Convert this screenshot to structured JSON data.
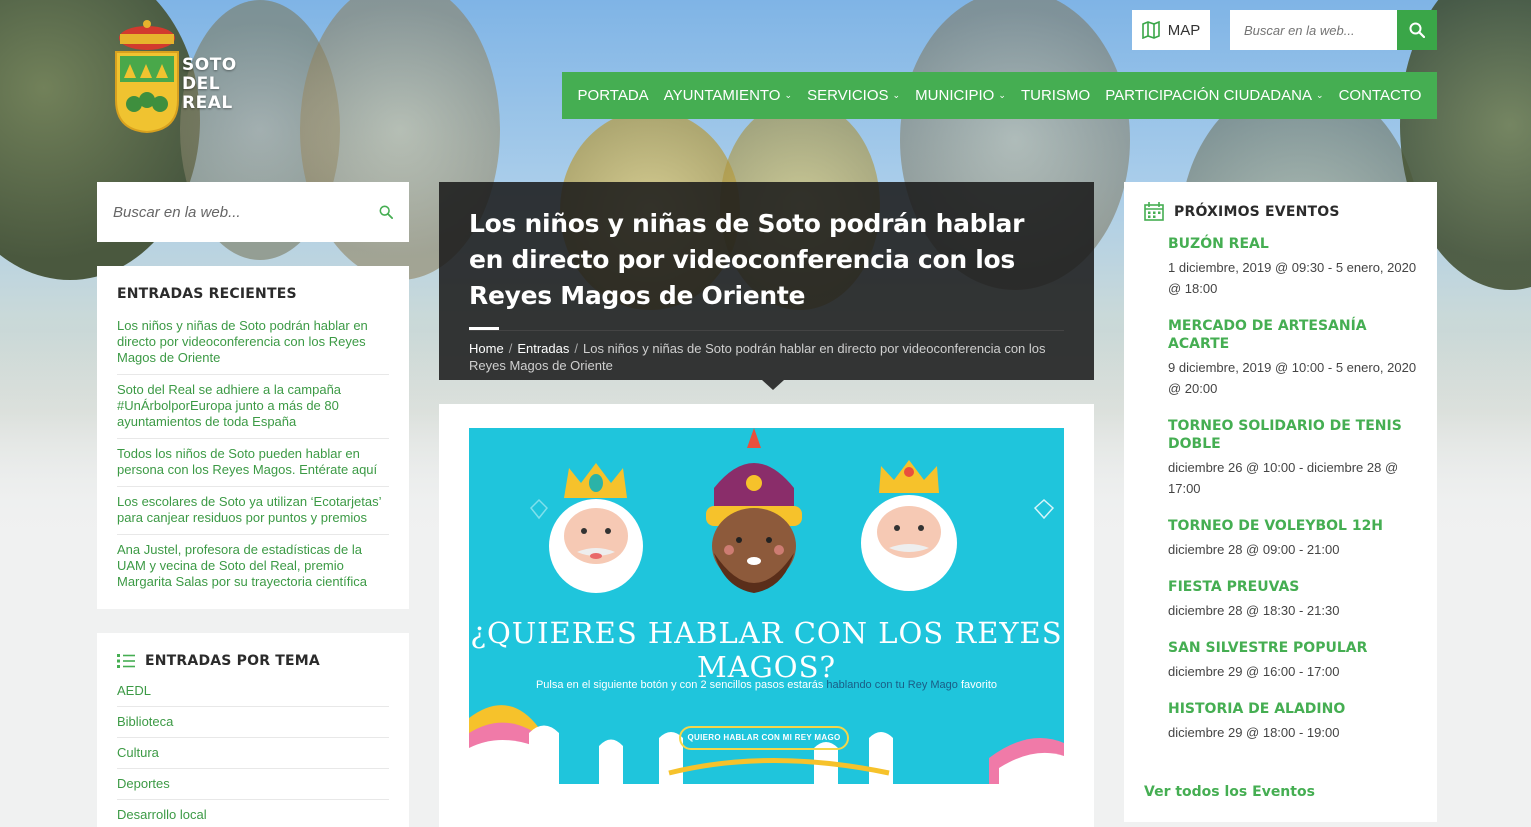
{
  "brand": {
    "line1": "SOTO",
    "line2": "DEL",
    "line3": "REAL"
  },
  "header": {
    "map_label": "MAP",
    "search_placeholder": "Buscar en la web..."
  },
  "nav": [
    {
      "label": "PORTADA",
      "dropdown": false
    },
    {
      "label": "AYUNTAMIENTO",
      "dropdown": true
    },
    {
      "label": "SERVICIOS",
      "dropdown": true
    },
    {
      "label": "MUNICIPIO",
      "dropdown": true
    },
    {
      "label": "TURISMO",
      "dropdown": false
    },
    {
      "label": "PARTICIPACIÓN CIUDADANA",
      "dropdown": true
    },
    {
      "label": "CONTACTO",
      "dropdown": false
    }
  ],
  "sidebar": {
    "search_placeholder": "Buscar en la web...",
    "recent_title": "ENTRADAS RECIENTES",
    "recent": [
      "Los niños y niñas de Soto podrán hablar en directo por videoconferencia con los Reyes Magos de Oriente",
      "Soto del Real se adhiere a la campaña #UnÁrbolporEuropa junto a más de 80 ayuntamientos de toda España",
      "Todos los niños de Soto pueden hablar en persona con los Reyes Magos. Entérate aquí",
      "Los escolares de Soto ya utilizan ‘Ecotarjetas’ para canjear residuos por puntos y premios",
      "Ana Justel, profesora de estadísticas de la UAM y vecina de Soto del Real, premio Margarita Salas por su trayectoria científica"
    ],
    "topics_title": "ENTRADAS POR TEMA",
    "topics": [
      "AEDL",
      "Biblioteca",
      "Cultura",
      "Deportes",
      "Desarrollo local"
    ]
  },
  "article": {
    "title": "Los niños y niñas de Soto podrán hablar en directo por videoconferencia con los Reyes Magos de Oriente",
    "breadcrumb": {
      "home": "Home",
      "section": "Entradas",
      "current": "Los niños y niñas de Soto podrán hablar en directo por videoconferencia con los Reyes Magos de Oriente"
    },
    "banner": {
      "headline": "¿QUIERES HABLAR CON LOS REYES MAGOS?",
      "sub_before": "Pulsa en el siguiente botón y con 2 sencillos pasos estarás ",
      "sub_highlight": "hablando con tu Rey Mago",
      "sub_after": " favorito",
      "button": "QUIERO HABLAR CON MI REY MAGO"
    }
  },
  "events": {
    "title": "PRÓXIMOS EVENTOS",
    "items": [
      {
        "name": "BUZÓN REAL",
        "when": "1 diciembre, 2019 @ 09:30 - 5 enero, 2020 @ 18:00"
      },
      {
        "name": "MERCADO DE ARTESANÍA ACARTE",
        "when": "9 diciembre, 2019 @ 10:00 - 5 enero, 2020 @ 20:00"
      },
      {
        "name": "TORNEO SOLIDARIO DE TENIS DOBLE",
        "when": "diciembre 26 @ 10:00 - diciembre 28 @ 17:00"
      },
      {
        "name": "TORNEO DE VOLEYBOL 12H",
        "when": "diciembre 28 @ 09:00 - 21:00"
      },
      {
        "name": "FIESTA PREUVAS",
        "when": "diciembre 28 @ 18:30 - 21:30"
      },
      {
        "name": "SAN SILVESTRE POPULAR",
        "when": "diciembre 29 @ 16:00 - 17:00"
      },
      {
        "name": "HISTORIA DE ALADINO",
        "when": "diciembre 29 @ 18:00 - 19:00"
      }
    ],
    "all_link": "Ver todos los Eventos"
  },
  "colors": {
    "brand_green": "#45ae52",
    "link_green": "#3c9a45",
    "banner_cyan": "#1fc5dc"
  }
}
